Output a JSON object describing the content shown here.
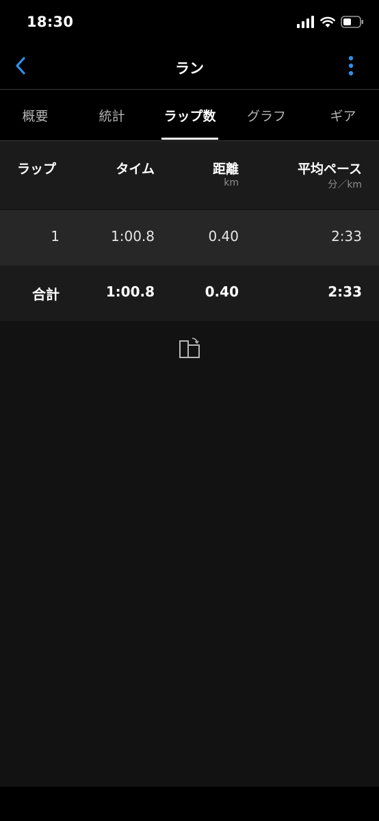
{
  "status_bar": {
    "time": "18:30"
  },
  "nav": {
    "title": "ラン"
  },
  "tabs": [
    {
      "label": "概要",
      "active": false
    },
    {
      "label": "統計",
      "active": false
    },
    {
      "label": "ラップ数",
      "active": true
    },
    {
      "label": "グラフ",
      "active": false
    },
    {
      "label": "ギア",
      "active": false
    }
  ],
  "table": {
    "columns": [
      {
        "label": "ラップ",
        "unit": ""
      },
      {
        "label": "タイム",
        "unit": ""
      },
      {
        "label": "距離",
        "unit": "km"
      },
      {
        "label": "平均ペース",
        "unit": "分／km"
      }
    ],
    "laps": [
      {
        "lap": "1",
        "time": "1:00.8",
        "distance": "0.40",
        "pace": "2:33"
      }
    ],
    "total": {
      "label": "合計",
      "time": "1:00.8",
      "distance": "0.40",
      "pace": "2:33"
    }
  },
  "icons": {
    "back": "chevron-left-icon",
    "more": "more-vertical-icon",
    "rotate": "rotate-screen-icon",
    "signal": "cellular-signal-icon",
    "wifi": "wifi-icon",
    "battery": "battery-icon"
  },
  "colors": {
    "accent": "#2e8fe6",
    "background": "#000000",
    "content_background": "#121212",
    "lap_row": "#272727"
  }
}
